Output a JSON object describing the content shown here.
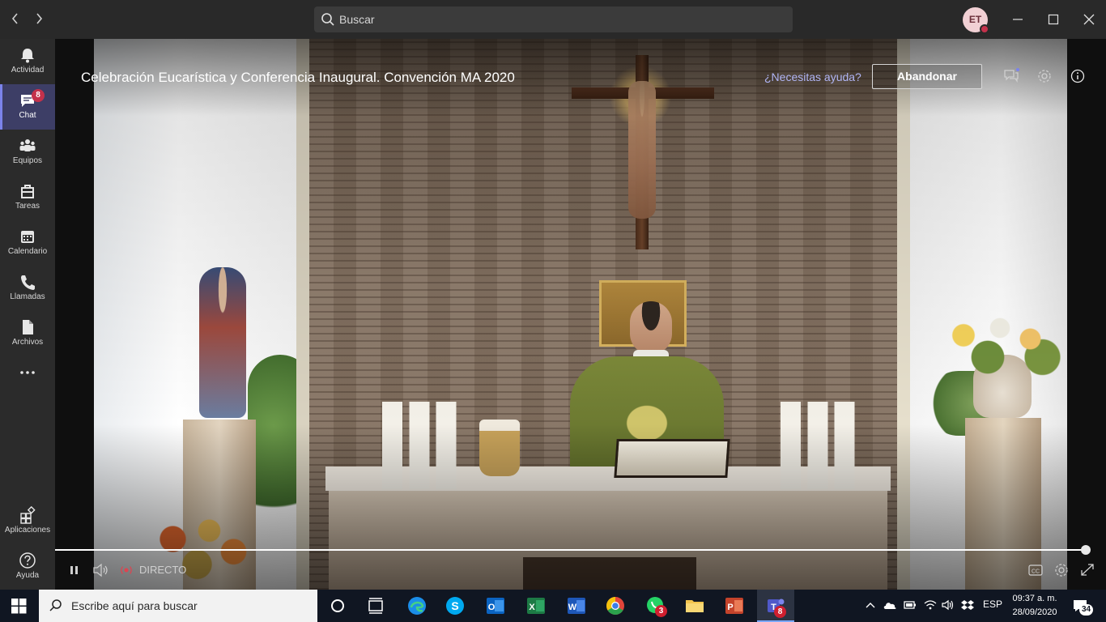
{
  "titlebar": {
    "search_placeholder": "Buscar",
    "avatar_initials": "ET"
  },
  "rail": {
    "items": [
      {
        "label": "Actividad",
        "icon": "bell-icon"
      },
      {
        "label": "Chat",
        "icon": "chat-icon",
        "badge": "8",
        "active": true
      },
      {
        "label": "Equipos",
        "icon": "teams-icon"
      },
      {
        "label": "Tareas",
        "icon": "tasks-icon"
      },
      {
        "label": "Calendario",
        "icon": "calendar-icon"
      },
      {
        "label": "Llamadas",
        "icon": "phone-icon"
      },
      {
        "label": "Archivos",
        "icon": "files-icon"
      },
      {
        "label": "Aplicaciones",
        "icon": "apps-icon"
      },
      {
        "label": "Ayuda",
        "icon": "help-icon"
      }
    ]
  },
  "stage": {
    "title": "Celebración Eucarística y Conferencia Inaugural. Convención MA 2020",
    "help_link": "¿Necesitas ayuda?",
    "leave_button": "Abandonar",
    "live_label": "DIRECTO",
    "playback_progress": 1.0
  },
  "taskbar": {
    "search_placeholder": "Escribe aquí para buscar",
    "whatsapp_badge": "3",
    "teams_badge": "8",
    "language": "ESP",
    "time": "09:37 a. m.",
    "date": "28/09/2020",
    "notifications_count": "34"
  },
  "colors": {
    "accent": "#7b83eb",
    "badge": "#c4314b",
    "rail_bg": "#2b2b2b",
    "titlebar_bg": "#292929"
  }
}
